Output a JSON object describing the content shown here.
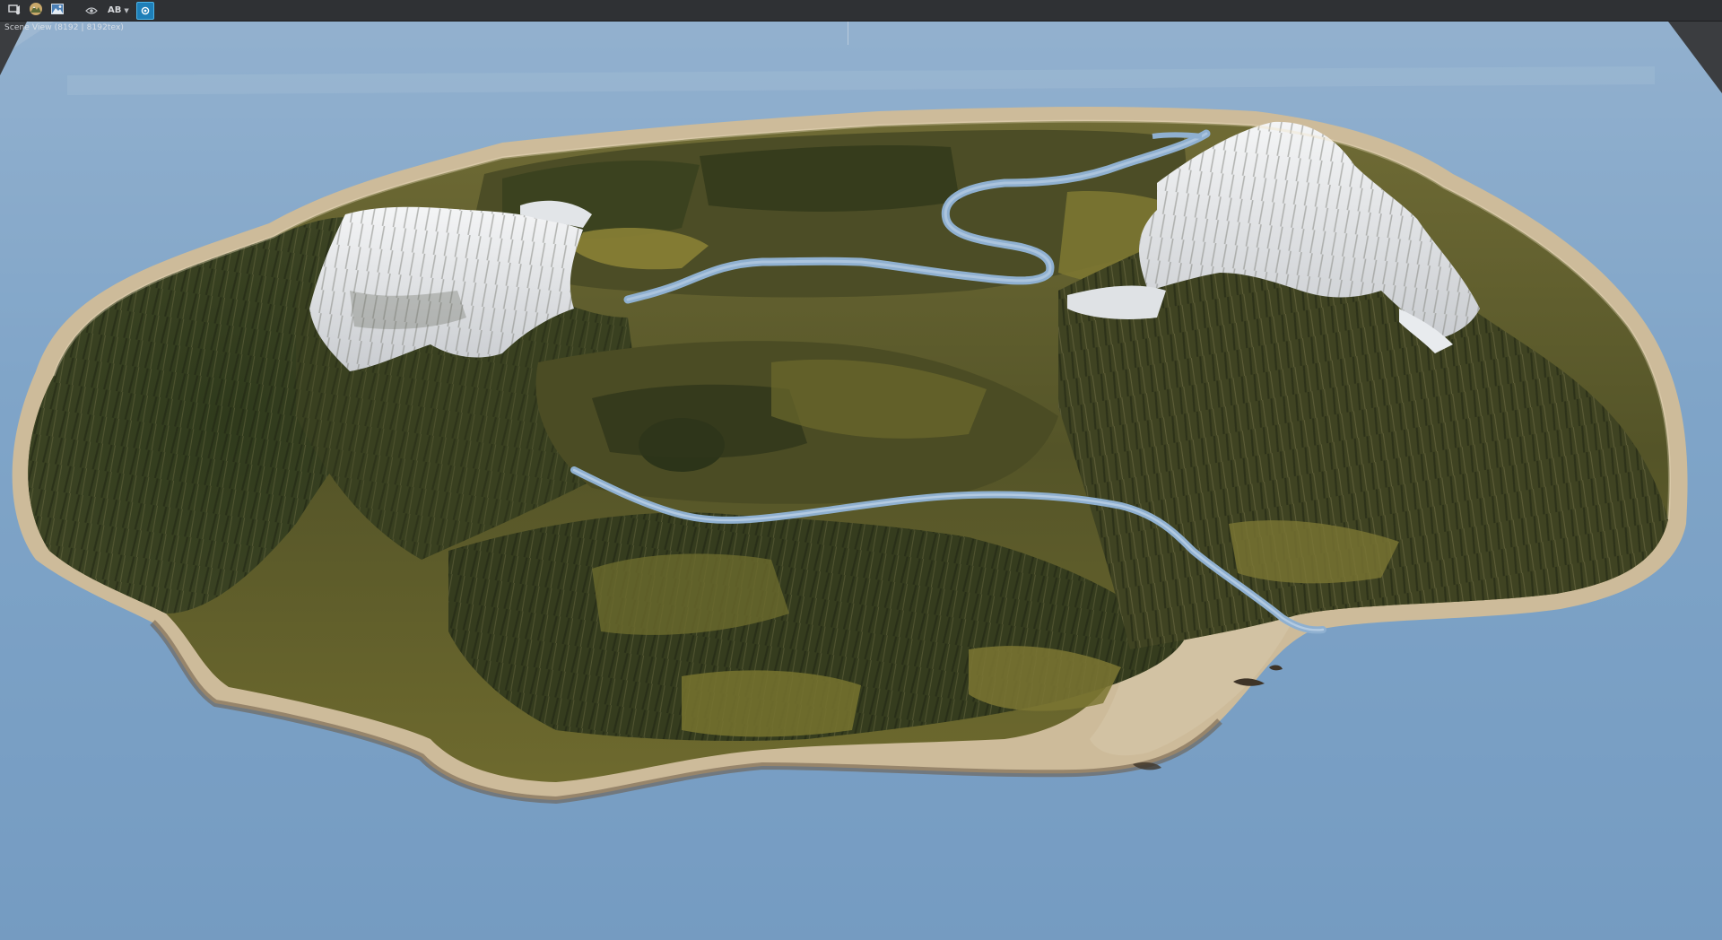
{
  "toolbar": {
    "ab_label": "AB"
  },
  "viewport": {
    "label": "Scene View (8192 | 8192tex)"
  },
  "colors": {
    "toolbar_bg": "#2f3134",
    "water": "#6f97bd",
    "sand": "#cdbb9a",
    "grass": "#7c7436",
    "forest": "#3a3f22",
    "snow": "#e9ecef",
    "river": "#8fb0d0",
    "active_tool": "#1e7fb8"
  },
  "icons": [
    "viewport-settings-icon",
    "terrain-tool-icon",
    "image-icon",
    "eye-icon",
    "ab-compare-icon",
    "active-mode-icon"
  ]
}
